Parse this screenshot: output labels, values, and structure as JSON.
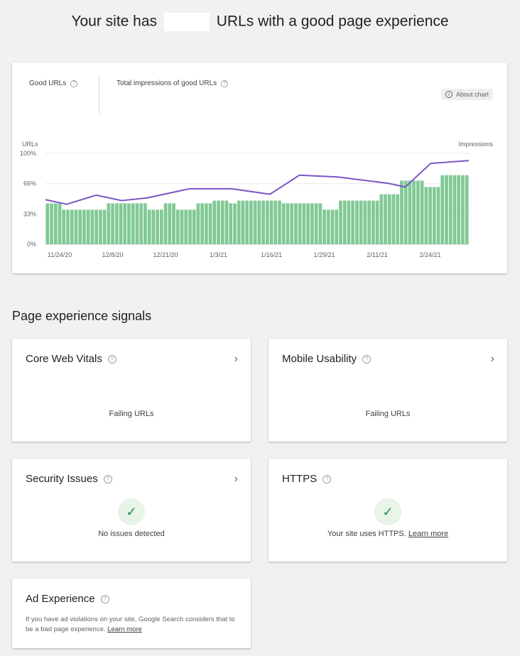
{
  "headline": {
    "prefix": "Your site has",
    "suffix": "URLs with a good page experience"
  },
  "summary": {
    "good_urls_label": "Good URLs",
    "impressions_label": "Total impressions of good URLs",
    "about_chart": "About chart",
    "help_glyph": "?",
    "info_glyph": "i"
  },
  "chart_data": {
    "type": "bar",
    "left_axis_label": "URLs",
    "right_axis_label": "Impressions",
    "y_ticks": [
      "100%",
      "66%",
      "33%",
      "0%"
    ],
    "ylim": [
      0,
      100
    ],
    "x_tick_labels": [
      "11/24/20",
      "12/8/20",
      "12/21/20",
      "1/3/21",
      "1/16/21",
      "1/29/21",
      "2/11/21",
      "2/24/21"
    ],
    "x_tick_indices": [
      3,
      16,
      29,
      42,
      55,
      68,
      81,
      94
    ],
    "bar_color": "#81c995",
    "line_color": "#7b55c4",
    "series": [
      {
        "type": "bar",
        "values": [
          45,
          45,
          45,
          45,
          38,
          38,
          38,
          38,
          38,
          38,
          38,
          38,
          38,
          38,
          38,
          45,
          45,
          45,
          45,
          45,
          45,
          45,
          45,
          45,
          45,
          38,
          38,
          38,
          38,
          45,
          45,
          45,
          38,
          38,
          38,
          38,
          38,
          45,
          45,
          45,
          45,
          48,
          48,
          48,
          48,
          45,
          45,
          48,
          48,
          48,
          48,
          48,
          48,
          48,
          48,
          48,
          48,
          48,
          45,
          45,
          45,
          45,
          45,
          45,
          45,
          45,
          45,
          45,
          38,
          38,
          38,
          38,
          48,
          48,
          48,
          48,
          48,
          48,
          48,
          48,
          48,
          48,
          55,
          55,
          55,
          55,
          55,
          70,
          70,
          70,
          70,
          70,
          70,
          63,
          63,
          63,
          63,
          76,
          76,
          76,
          76,
          76,
          76,
          76
        ]
      },
      {
        "type": "line",
        "points": [
          [
            0,
            49
          ],
          [
            5,
            44
          ],
          [
            12,
            54
          ],
          [
            18,
            48
          ],
          [
            24,
            51
          ],
          [
            34,
            61
          ],
          [
            44,
            61
          ],
          [
            53,
            55
          ],
          [
            60,
            76
          ],
          [
            69,
            74
          ],
          [
            81,
            67
          ],
          [
            85,
            63
          ],
          [
            91,
            89
          ],
          [
            100,
            92
          ]
        ]
      }
    ]
  },
  "section_title": "Page experience signals",
  "cards": {
    "cwv": {
      "title": "Core Web Vitals",
      "body": "Failing URLs",
      "chevron": "›"
    },
    "mobile": {
      "title": "Mobile Usability",
      "body": "Failing URLs",
      "chevron": "›"
    },
    "security": {
      "title": "Security Issues",
      "body": "No issues detected",
      "chevron": "›",
      "check": "✓"
    },
    "https": {
      "title": "HTTPS",
      "body": "Your site uses HTTPS.",
      "link": "Learn more",
      "check": "✓"
    },
    "ad": {
      "title": "Ad Experience",
      "body": "If you have ad violations on your site, Google Search considers that to be a bad page experience.",
      "link": "Learn more"
    }
  }
}
